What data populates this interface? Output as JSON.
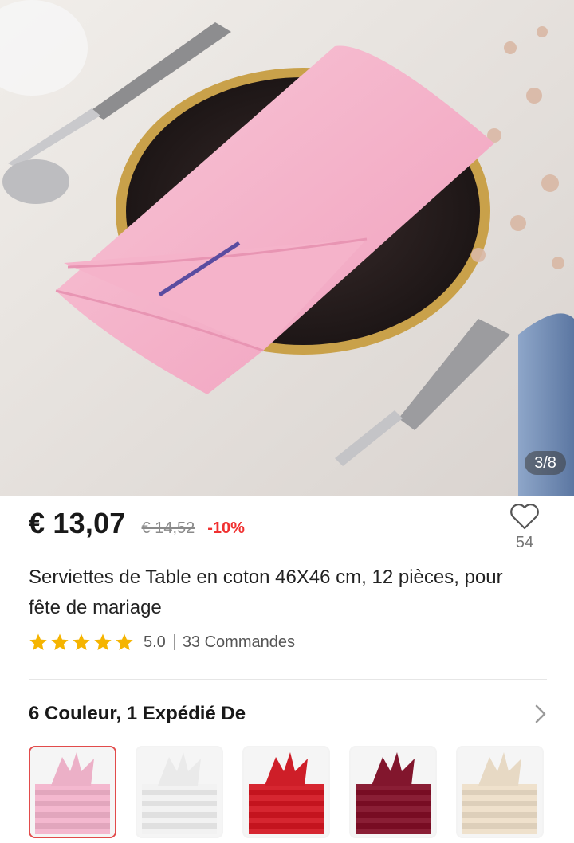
{
  "gallery": {
    "counter": "3/8",
    "image_alt": "Pink napkin folded on a plate with cutlery"
  },
  "product": {
    "price": "€ 13,07",
    "old_price": "€ 14,52",
    "discount": "-10%",
    "wishlist_count": "54",
    "title": "Serviettes de Table en coton 46X46 cm, 12 pièces, pour fête de mariage",
    "rating": "5.0",
    "rating_stars": 5,
    "orders": "33 Commandes"
  },
  "variants": {
    "heading": "6 Couleur, 1 Expédié De",
    "options": [
      {
        "color": "#f4b8cf",
        "selected": true
      },
      {
        "color": "#f2f2f2",
        "selected": false
      },
      {
        "color": "#d62630",
        "selected": false
      },
      {
        "color": "#8a1e35",
        "selected": false
      },
      {
        "color": "#efe1cc",
        "selected": false
      }
    ]
  },
  "colors": {
    "accent": "#f03030",
    "star": "#f5b400",
    "selected_border": "#e24b4b"
  }
}
